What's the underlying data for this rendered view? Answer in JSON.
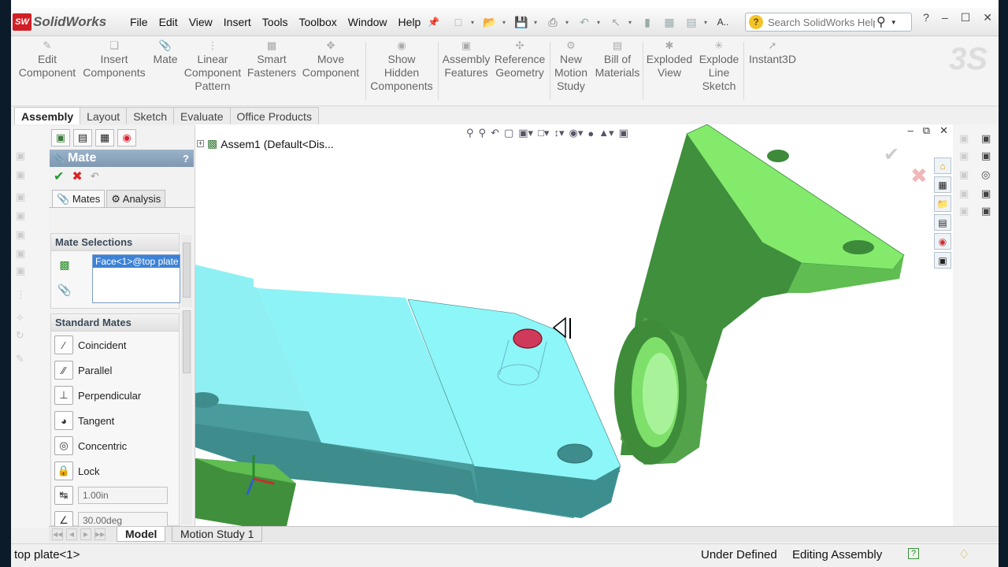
{
  "app": {
    "logo_text": "SolidWorks",
    "logo_mark": "SW"
  },
  "menu": [
    "File",
    "Edit",
    "View",
    "Insert",
    "Tools",
    "Toolbox",
    "Window",
    "Help"
  ],
  "search": {
    "placeholder": "Search SolidWorks Help",
    "value": "Search SolidWorks Help"
  },
  "qa_text": "A..",
  "window_controls": [
    "?",
    "–",
    "☐",
    "✕"
  ],
  "commands": [
    {
      "label": "Edit\nComponent",
      "icon": "edit-component-icon"
    },
    {
      "label": "Insert\nComponents",
      "icon": "insert-components-icon"
    },
    {
      "label": "Mate",
      "icon": "mate-icon"
    },
    {
      "label": "Linear\nComponent\nPattern",
      "icon": "linear-pattern-icon"
    },
    {
      "label": "Smart\nFasteners",
      "icon": "smart-fasteners-icon"
    },
    {
      "label": "Move\nComponent",
      "icon": "move-component-icon"
    },
    {
      "label": "Show\nHidden\nComponents",
      "icon": "show-hidden-icon"
    },
    {
      "label": "Assembly\nFeatures",
      "icon": "assembly-features-icon"
    },
    {
      "label": "Reference\nGeometry",
      "icon": "reference-geometry-icon"
    },
    {
      "label": "New\nMotion\nStudy",
      "icon": "motion-study-icon"
    },
    {
      "label": "Bill of\nMaterials",
      "icon": "bom-icon"
    },
    {
      "label": "Exploded\nView",
      "icon": "exploded-view-icon"
    },
    {
      "label": "Explode\nLine\nSketch",
      "icon": "explode-line-icon"
    },
    {
      "label": "Instant3D",
      "icon": "instant3d-icon"
    }
  ],
  "tabs": [
    "Assembly",
    "Layout",
    "Sketch",
    "Evaluate",
    "Office Products"
  ],
  "property_manager": {
    "title": "Mate",
    "help": "?",
    "subtabs": [
      "Mates",
      "Analysis"
    ],
    "mate_selections_title": "Mate Selections",
    "selection_item": "Face<1>@top plate",
    "standard_mates_title": "Standard Mates",
    "mates": [
      "Coincident",
      "Parallel",
      "Perpendicular",
      "Tangent",
      "Concentric",
      "Lock"
    ],
    "distance_value": "1.00in",
    "angle_value": "30.00deg"
  },
  "graphics": {
    "tree_root": "Assem1  (Default<Dis..."
  },
  "bottom_tabs": [
    "Model",
    "Motion Study 1"
  ],
  "status": {
    "left": "top plate<1>",
    "definition": "Under Defined",
    "mode": "Editing Assembly",
    "help": "?"
  }
}
